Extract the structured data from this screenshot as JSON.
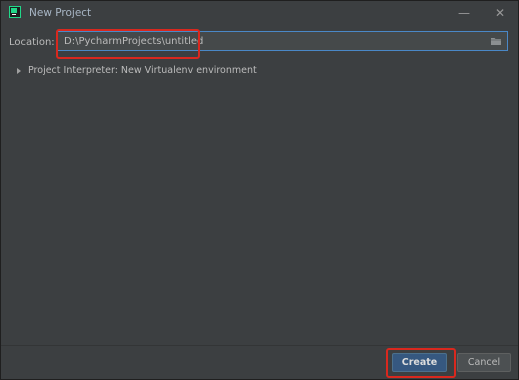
{
  "window": {
    "title": "New Project",
    "minimize_glyph": "—",
    "close_glyph": "✕"
  },
  "location": {
    "label": "Location:",
    "value": "D:\\PycharmProjects\\untitled",
    "browse_icon": "folder-icon"
  },
  "interpreter": {
    "label": "Project Interpreter: New Virtualenv environment",
    "expanded": false
  },
  "buttons": {
    "create": "Create",
    "cancel": "Cancel"
  },
  "colors": {
    "background": "#3c3f41",
    "field_border": "#4a88c7",
    "primary_button": "#365880",
    "annotation_red": "#d9281e"
  }
}
